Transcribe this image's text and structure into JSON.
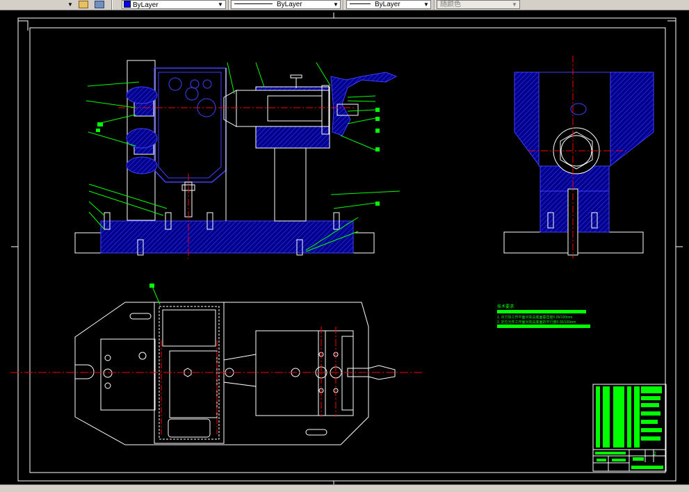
{
  "toolbar": {
    "layer_selector": "ByLayer",
    "linetype_selector": "ByLayer",
    "lineweight_selector": "ByLayer",
    "plotstyle_selector": "随颜色"
  },
  "drawing": {
    "tech_req_title": "技术要求:",
    "tech_req_items": [
      "1. 对刀块工作平面对夹具底面垂直度0.05/100mm",
      "2. 定位元件工作面对夹具底面的平行度0.05/100mm"
    ],
    "title_block_sheet": "2"
  },
  "colors": {
    "background": "#000000",
    "outline": "#ffffff",
    "part": "#0000ff",
    "hatch": "#2a2aff",
    "centerline": "#ff0000",
    "leader": "#00ff00",
    "toolbar": "#d4d0c8"
  }
}
